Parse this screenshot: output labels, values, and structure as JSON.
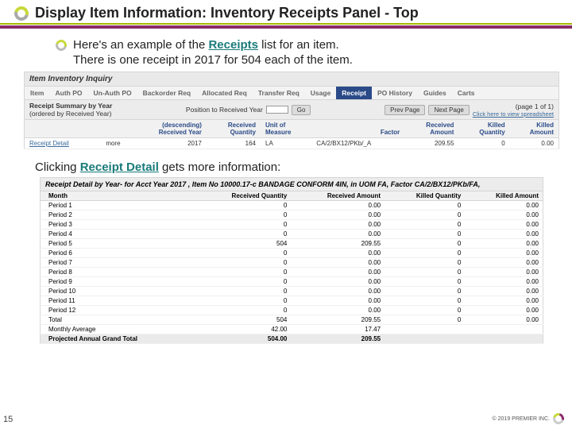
{
  "title": "Display Item Information: Inventory Receipts Panel - Top",
  "intro": {
    "line1_pre": "Here's an example of the ",
    "line1_link": "Receipts",
    "line1_post": " list for an item.",
    "line2": "There is one receipt in 2017 for 504 each of the item."
  },
  "inquiry_bar": "Item Inventory Inquiry",
  "tabs": [
    "Item",
    "Auth PO",
    "Un-Auth PO",
    "Backorder Req",
    "Allocated Req",
    "Transfer Req",
    "Usage",
    "Receipt",
    "PO History",
    "Guides",
    "Carts"
  ],
  "active_tab_index": 7,
  "summary": {
    "title": "Receipt Summary by Year",
    "subtitle": "(ordered by Received Year)",
    "position_label": "Position to Received Year",
    "go": "Go",
    "prev": "Prev Page",
    "next": "Next Page",
    "page_info": "(page 1 of 1)",
    "spread_link": "Click here to view spreadsheet"
  },
  "receipt_headers": [
    "",
    "(descending)\nReceived Year",
    "Received\nQuantity",
    "Unit of\nMeasure",
    "Factor",
    "Received\nAmount",
    "Killed\nQuantity",
    "Killed\nAmount"
  ],
  "receipt_row": {
    "link": "Receipt Detail",
    "mark": "more",
    "year": "2017",
    "qty": "164",
    "uom": "LA",
    "factor": "CA/2/BX12/PKb/_A",
    "amount": "209.55",
    "killed_qty": "0",
    "killed_amt": "0.00"
  },
  "mid_sentence_pre": "Clicking ",
  "mid_sentence_link": "Receipt Detail",
  "mid_sentence_post": " gets more information:",
  "detail_title": "Receipt Detail by Year- for Acct Year 2017 , Item No 10000.17-c BANDAGE CONFORM 4IN, in UOM FA, Factor CA/2/BX12/PKb/FA,",
  "detail_headers": [
    "Month",
    "Received Quantity",
    "Received Amount",
    "Killed Quantity",
    "Killed Amount"
  ],
  "detail_rows": [
    {
      "month": "Period 1",
      "rq": "0",
      "ra": "0.00",
      "kq": "0",
      "ka": "0.00"
    },
    {
      "month": "Period 2",
      "rq": "0",
      "ra": "0.00",
      "kq": "0",
      "ka": "0.00"
    },
    {
      "month": "Period 3",
      "rq": "0",
      "ra": "0.00",
      "kq": "0",
      "ka": "0.00"
    },
    {
      "month": "Period 4",
      "rq": "0",
      "ra": "0.00",
      "kq": "0",
      "ka": "0.00"
    },
    {
      "month": "Period 5",
      "rq": "504",
      "ra": "209.55",
      "kq": "0",
      "ka": "0.00"
    },
    {
      "month": "Period 6",
      "rq": "0",
      "ra": "0.00",
      "kq": "0",
      "ka": "0.00"
    },
    {
      "month": "Period 7",
      "rq": "0",
      "ra": "0.00",
      "kq": "0",
      "ka": "0.00"
    },
    {
      "month": "Period 8",
      "rq": "0",
      "ra": "0.00",
      "kq": "0",
      "ka": "0.00"
    },
    {
      "month": "Period 9",
      "rq": "0",
      "ra": "0.00",
      "kq": "0",
      "ka": "0.00"
    },
    {
      "month": "Period 10",
      "rq": "0",
      "ra": "0.00",
      "kq": "0",
      "ka": "0.00"
    },
    {
      "month": "Period 11",
      "rq": "0",
      "ra": "0.00",
      "kq": "0",
      "ka": "0.00"
    },
    {
      "month": "Period 12",
      "rq": "0",
      "ra": "0.00",
      "kq": "0",
      "ka": "0.00"
    },
    {
      "month": "Total",
      "rq": "504",
      "ra": "209.55",
      "kq": "0",
      "ka": "0.00"
    },
    {
      "month": "Monthly Average",
      "rq": "42.00",
      "ra": "17.47",
      "kq": "",
      "ka": ""
    },
    {
      "month": "Projected Annual Grand Total",
      "rq": "504.00",
      "ra": "209.55",
      "kq": "",
      "ka": "",
      "projected": true
    }
  ],
  "footer": {
    "page": "15",
    "copyright": "© 2019 PREMIER INC."
  }
}
